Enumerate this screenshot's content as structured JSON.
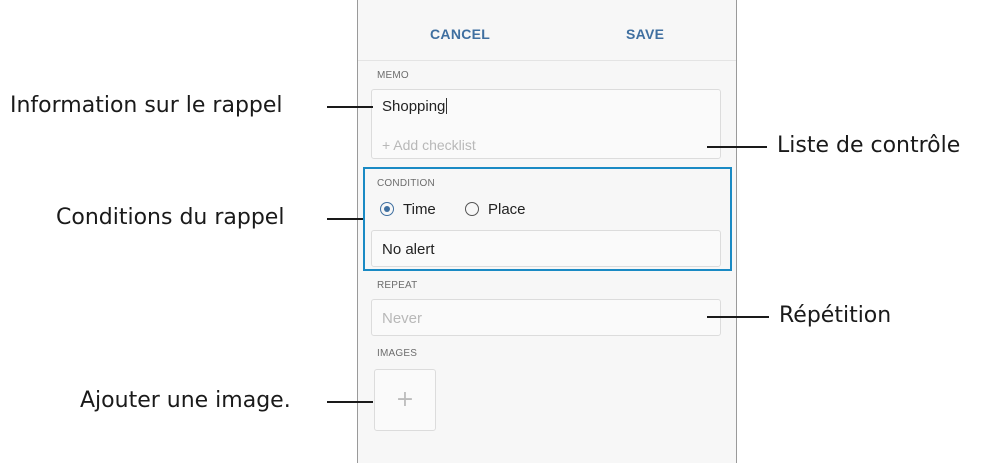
{
  "toolbar": {
    "cancel_label": "CANCEL",
    "save_label": "SAVE"
  },
  "memo": {
    "label": "MEMO",
    "value": "Shopping",
    "add_checklist": "+ Add checklist"
  },
  "condition": {
    "label": "CONDITION",
    "options": [
      {
        "label": "Time",
        "selected": true
      },
      {
        "label": "Place",
        "selected": false
      }
    ],
    "alert_value": "No alert"
  },
  "repeat": {
    "label": "REPEAT",
    "value": "Never"
  },
  "images": {
    "label": "IMAGES",
    "add_icon": "plus-icon"
  },
  "callouts": {
    "reminder_info": "Information sur le rappel",
    "checklist": "Liste de contrôle",
    "conditions": "Conditions du rappel",
    "repetition": "Répétition",
    "add_image": "Ajouter une image."
  },
  "colors": {
    "accent": "#3f6fa0",
    "highlight_frame": "#1a8ac4"
  }
}
